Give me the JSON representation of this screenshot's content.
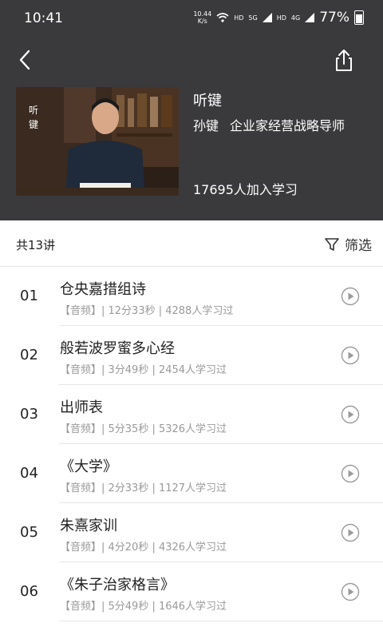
{
  "status_bar": {
    "time": "10:41",
    "speed_top": "10.44",
    "speed_bottom": "K/s",
    "hd1": "HD",
    "signal1": "5G",
    "hd2": "HD",
    "signal2": "4G",
    "battery": "77%"
  },
  "course": {
    "cover_text": "听键",
    "title": "听键",
    "teacher_name": "孙键",
    "teacher_title": "企业家经营战略导师",
    "learners": "17695人加入学习"
  },
  "list_bar": {
    "count": "共13讲",
    "filter_label": "筛选"
  },
  "lectures": [
    {
      "no": "01",
      "title": "仓央嘉措组诗",
      "meta": "【音频】| 12分33秒 | 4288人学习过"
    },
    {
      "no": "02",
      "title": "般若波罗蜜多心经",
      "meta": "【音频】| 3分49秒 | 2454人学习过"
    },
    {
      "no": "03",
      "title": "出师表",
      "meta": "【音频】| 5分35秒 | 5326人学习过"
    },
    {
      "no": "04",
      "title": "《大学》",
      "meta": "【音频】| 2分33秒 | 1127人学习过"
    },
    {
      "no": "05",
      "title": "朱熹家训",
      "meta": "【音频】| 4分20秒 | 4326人学习过"
    },
    {
      "no": "06",
      "title": "《朱子治家格言》",
      "meta": "【音频】| 5分49秒 | 1646人学习过"
    }
  ]
}
